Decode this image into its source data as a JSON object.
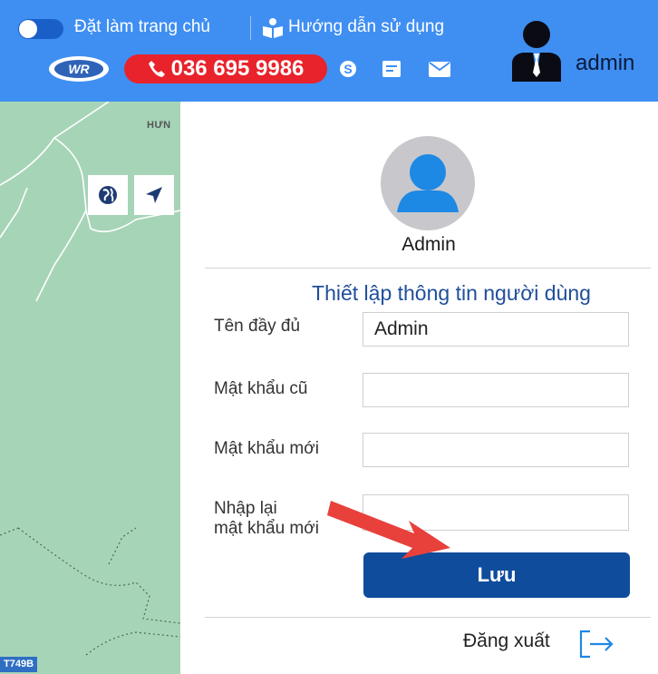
{
  "header": {
    "homepage_label": "Đặt làm trang chủ",
    "guide_label": "Hướng dẫn sử dụng",
    "logo_text": "WR",
    "phone": "036 695 9986",
    "username": "admin",
    "brand_color": "#3f8ff2",
    "phone_color": "#e8232b"
  },
  "map": {
    "place_label": "HƯN",
    "road_label": "T749B",
    "controls": [
      "globe-icon",
      "location-arrow-icon"
    ]
  },
  "profile_panel": {
    "name": "Admin",
    "title": "Thiết lập thông tin người dùng",
    "fields": [
      {
        "label": "Tên đầy đủ",
        "value": "Admin"
      },
      {
        "label": "Mật khẩu cũ",
        "value": ""
      },
      {
        "label": "Mật khẩu mới",
        "value": ""
      },
      {
        "label_line1": "Nhập lại",
        "label_line2": "mật khẩu mới",
        "value": ""
      }
    ],
    "save_label": "Lưu",
    "logout_label": "Đăng xuất",
    "save_color": "#0f4c9c"
  }
}
